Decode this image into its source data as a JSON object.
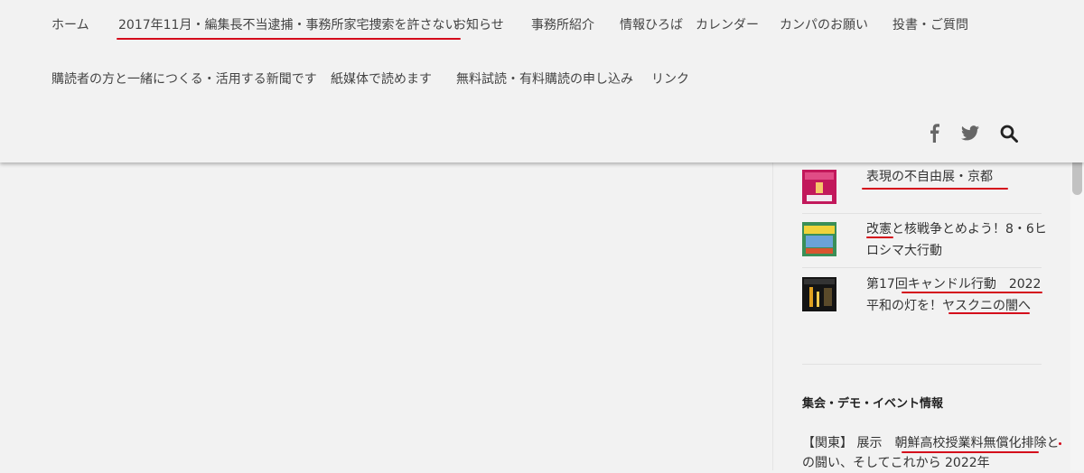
{
  "nav": {
    "row1": [
      {
        "label": "ホーム"
      },
      {
        "label": "2017年11月・編集長不当逮捕・事務所家宅捜索を許さない"
      },
      {
        "label": "お知らせ"
      },
      {
        "label": "事務所紹介"
      },
      {
        "label": "情報ひろば　カレンダー"
      },
      {
        "label": "カンパのお願い"
      },
      {
        "label": "投書・ご質問"
      }
    ],
    "row2": [
      {
        "label": "購読者の方と一緒につくる・活用する新聞です"
      },
      {
        "label": "紙媒体で読めます"
      },
      {
        "label": "無料試読・有料購読の申し込み"
      },
      {
        "label": "リンク"
      }
    ]
  },
  "social": {
    "facebook_icon": "facebook-icon",
    "twitter_icon": "twitter-icon",
    "search_icon": "search-icon"
  },
  "sidebar": {
    "posts": [
      {
        "title": "表現の不自由展・京都"
      },
      {
        "title": "改憲と核戦争とめよう！8・6ヒロシマ大行動"
      },
      {
        "title": "第17回キャンドル行動　2022平和の灯を！ヤスクニの闇へ"
      }
    ],
    "widget_title": "集会・デモ・イベント情報",
    "event_text": "【関東】 展示　朝鮮高校授業料無償化排除との闘い、そしてこれから 2022年"
  },
  "colors": {
    "background": "#f2f2f2",
    "underline": "#d40b1b",
    "text": "#333333"
  }
}
